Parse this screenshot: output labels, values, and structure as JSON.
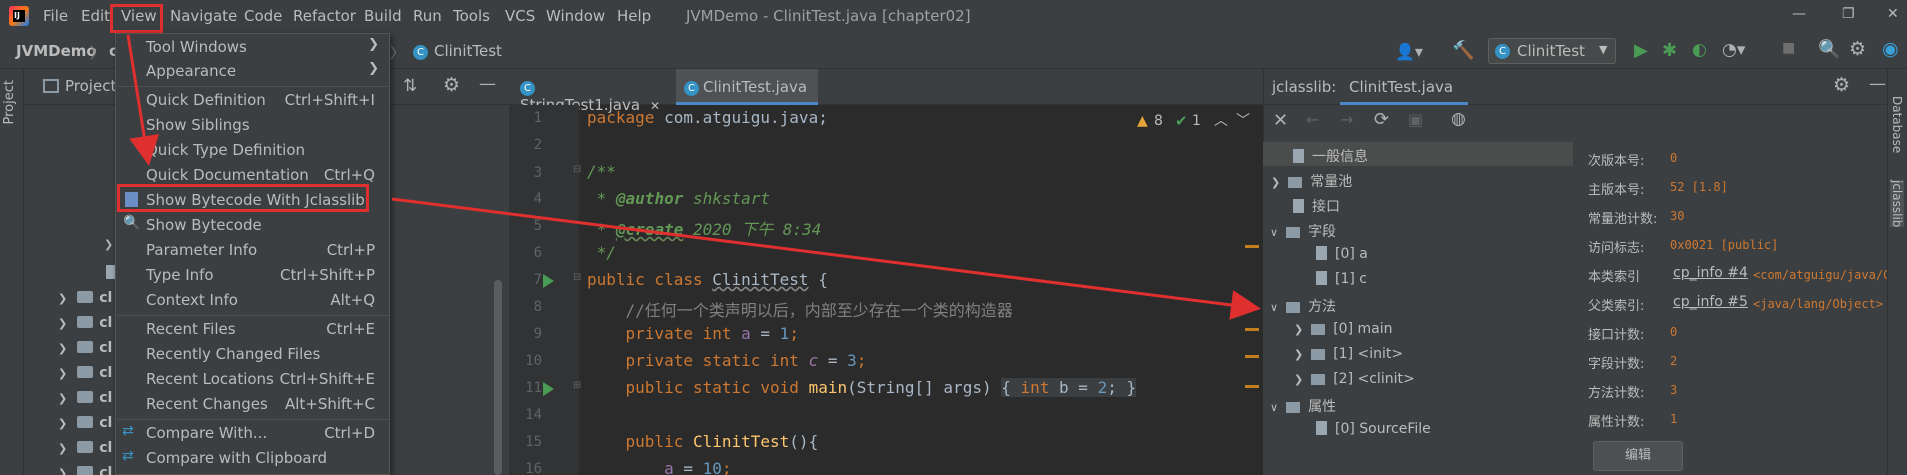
{
  "menubar": {
    "items": [
      "File",
      "Edit",
      "View",
      "Navigate",
      "Code",
      "Refactor",
      "Build",
      "Run",
      "Tools",
      "VCS",
      "Window",
      "Help"
    ],
    "title": "JVMDemo - ClinitTest.java [chapter02]"
  },
  "navbar": {
    "project": "JVMDemo",
    "crumb_partial": "c",
    "file": "ClinitTest",
    "run_config": "ClinitTest"
  },
  "project_panel": {
    "title": "Project",
    "vertical_label": "Project",
    "rows": [
      "cl",
      "cl",
      "cl",
      "cl",
      "cl",
      "cl",
      "cl",
      "cl"
    ]
  },
  "view_menu": {
    "items": [
      {
        "label": "Tool Windows",
        "shortcut": "",
        "submenu": true
      },
      {
        "label": "Appearance",
        "shortcut": "",
        "submenu": true
      },
      {
        "label": "Quick Definition",
        "shortcut": "Ctrl+Shift+I"
      },
      {
        "label": "Show Siblings",
        "shortcut": ""
      },
      {
        "label": "Quick Type Definition",
        "shortcut": ""
      },
      {
        "label": "Quick Documentation",
        "shortcut": "Ctrl+Q"
      },
      {
        "label": "Show Bytecode With Jclasslib",
        "shortcut": ""
      },
      {
        "label": "Show Bytecode",
        "shortcut": ""
      },
      {
        "label": "Parameter Info",
        "shortcut": "Ctrl+P"
      },
      {
        "label": "Type Info",
        "shortcut": "Ctrl+Shift+P"
      },
      {
        "label": "Context Info",
        "shortcut": "Alt+Q"
      },
      {
        "label": "Recent Files",
        "shortcut": "Ctrl+E"
      },
      {
        "label": "Recently Changed Files",
        "shortcut": ""
      },
      {
        "label": "Recent Locations",
        "shortcut": "Ctrl+Shift+E"
      },
      {
        "label": "Recent Changes",
        "shortcut": "Alt+Shift+C"
      },
      {
        "label": "Compare With...",
        "shortcut": "Ctrl+D"
      },
      {
        "label": "Compare with Clipboard",
        "shortcut": ""
      }
    ]
  },
  "editor": {
    "tabs": [
      "StringTest1.java",
      "ClinitTest.java"
    ],
    "inspection": {
      "warnings": "8",
      "ok": "1"
    },
    "line_numbers": [
      "1",
      "2",
      "3",
      "4",
      "5",
      "6",
      "7",
      "8",
      "9",
      "10",
      "11",
      "14",
      "15",
      "16"
    ],
    "code": {
      "l1_kw": "package",
      "l1_rest": " com.atguigu.java;",
      "l3": "/**",
      "l4_star": " * ",
      "l4_tag": "@author",
      "l4_rest": " shkstart",
      "l5_star": " * ",
      "l5_tag": "@create",
      "l5_rest": " 2020 下午 8:34",
      "l6": " */",
      "l7_kw": "public class ",
      "l7_name": "ClinitTest",
      "l7_brace": " {",
      "l8": "    //任何一个类声明以后，内部至少存在一个类的构造器",
      "l9_kw": "    private int ",
      "l9_f": "a",
      "l9_eq": " = ",
      "l9_n": "1",
      "l9_end": ";",
      "l10_kw": "    private static int ",
      "l10_f": "c",
      "l10_eq": " = ",
      "l10_n": "3",
      "l10_end": ";",
      "l11_kw": "    public static void ",
      "l11_fn": "main",
      "l11_args": "(String[] args) ",
      "l11_body1": "{ ",
      "l11_body_kw": "int",
      "l11_body2": " b = ",
      "l11_body_n": "2",
      "l11_body3": "; }",
      "l15_kw": "    public ",
      "l15_fn": "ClinitTest",
      "l15_rest": "(){",
      "l16_f": "        a",
      "l16_eq": " = ",
      "l16_n": "10",
      "l16_end": ";"
    }
  },
  "jclasslib": {
    "label": "jclasslib:",
    "tab": "ClinitTest.java",
    "tree": {
      "general": "一般信息",
      "constant_pool": "常量池",
      "interfaces": "接口",
      "fields": "字段",
      "field0": "[0] a",
      "field1": "[1] c",
      "methods": "方法",
      "method0": "[0] main",
      "method1": "[1] <init>",
      "method2": "[2] <clinit>",
      "attributes": "属性",
      "attr0": "[0] SourceFile"
    },
    "detail": {
      "minor_k": "次版本号:",
      "minor_v": "0",
      "major_k": "主版本号:",
      "major_v": "52 [1.8]",
      "cp_count_k": "常量池计数:",
      "cp_count_v": "30",
      "access_k": "访问标志:",
      "access_v": "0x0021 [public]",
      "this_k": "本类索引",
      "this_link": "cp_info #4",
      "this_v": "<com/atguigu/java/Cl",
      "super_k": "父类索引:",
      "super_link": "cp_info #5",
      "super_v": "<java/lang/Object>",
      "iface_k": "接口计数:",
      "iface_v": "0",
      "field_k": "字段计数:",
      "field_v": "2",
      "method_k": "方法计数:",
      "method_v": "3",
      "attr_k": "属性计数:",
      "attr_v": "1",
      "edit_button": "编辑"
    },
    "right_stripe": [
      "Database",
      "jclasslib"
    ]
  },
  "colors": {
    "annotation_red": "#e02f2f",
    "accent": "#4a88c7",
    "run_green": "#499c54"
  }
}
